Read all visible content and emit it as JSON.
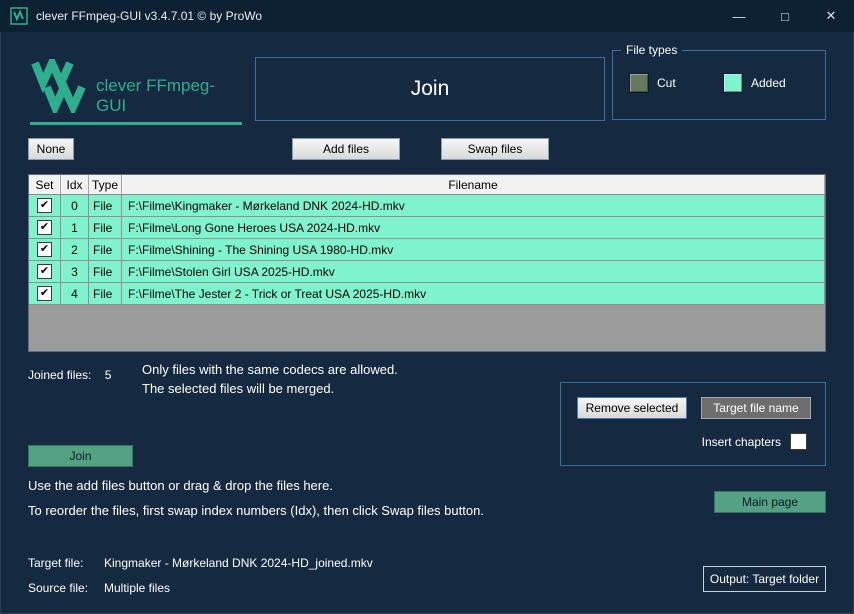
{
  "window": {
    "title": "clever FFmpeg-GUI v3.4.7.01   © by ProWo",
    "controls": {
      "minimize": "—",
      "maximize": "□",
      "close": "✕"
    }
  },
  "header": {
    "logo_text": "clever FFmpeg-GUI",
    "page_title": "Join",
    "file_types": {
      "label": "File types",
      "items": [
        {
          "label": "Cut",
          "color": "#66795f"
        },
        {
          "label": "Added",
          "color": "#7ff3cd"
        }
      ]
    }
  },
  "toolbar": {
    "none_label": "None",
    "add_files_label": "Add files",
    "swap_files_label": "Swap files"
  },
  "table": {
    "columns": [
      "Set",
      "Idx",
      "Type",
      "Filename"
    ],
    "rows": [
      {
        "set": true,
        "idx": "0",
        "type": "File",
        "filename": "F:\\Filme\\Kingmaker - Mørkeland DNK 2024-HD.mkv"
      },
      {
        "set": true,
        "idx": "1",
        "type": "File",
        "filename": "F:\\Filme\\Long Gone Heroes USA 2024-HD.mkv"
      },
      {
        "set": true,
        "idx": "2",
        "type": "File",
        "filename": "F:\\Filme\\Shining - The Shining USA 1980-HD.mkv"
      },
      {
        "set": true,
        "idx": "3",
        "type": "File",
        "filename": "F:\\Filme\\Stolen Girl USA 2025-HD.mkv"
      },
      {
        "set": true,
        "idx": "4",
        "type": "File",
        "filename": "F:\\Filme\\The Jester 2 - Trick or Treat USA 2025-HD.mkv"
      }
    ]
  },
  "status": {
    "joined_files_label": "Joined files:",
    "joined_files_count": "5"
  },
  "info": {
    "line1": "Only files with the same codecs are allowed.",
    "line2": "The selected files will be merged."
  },
  "actions": {
    "remove_selected": "Remove selected",
    "target_file_name": "Target file name",
    "insert_chapters": "Insert chapters",
    "join": "Join",
    "main_page": "Main page"
  },
  "hints": {
    "line1": "Use the add files button or drag & drop the files here.",
    "line2": "To reorder the files, first swap index numbers (Idx), then click Swap files button."
  },
  "footer": {
    "target_file_label": "Target file:",
    "target_file_value": "Kingmaker - Mørkeland DNK 2024-HD_joined.mkv",
    "source_file_label": "Source file:",
    "source_file_value": "Multiple files",
    "output_button": "Output: Target folder"
  }
}
